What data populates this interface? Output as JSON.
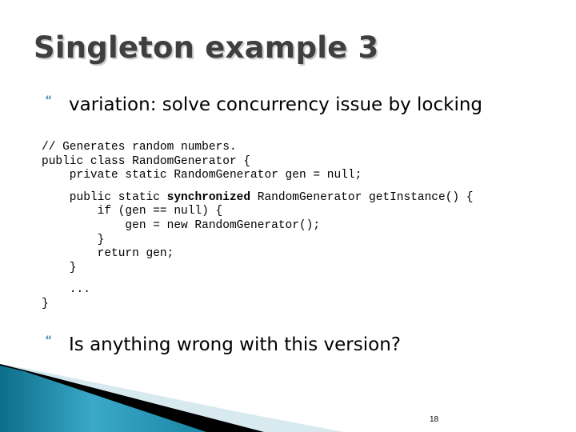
{
  "slide": {
    "title": "Singleton example 3",
    "bullets": [
      {
        "icon": "bullet-quote-icon",
        "text": "variation: solve concurrency issue by locking"
      },
      {
        "icon": "bullet-quote-icon",
        "text": "Is anything wrong with this version?"
      }
    ],
    "code": {
      "line1": "// Generates random numbers.",
      "line2": "public class RandomGenerator {",
      "line3": "    private static RandomGenerator gen = null;",
      "line4_pre": "    public static ",
      "line4_kw": "synchronized",
      "line4_post": " RandomGenerator getInstance() {",
      "line5": "        if (gen == null) {",
      "line6": "            gen = new RandomGenerator();",
      "line7": "        }",
      "line8": "        return gen;",
      "line9": "    }",
      "line10": "    ...",
      "line11": "}"
    },
    "page_number": "18",
    "colors": {
      "title": "#3f3f3f",
      "bullet": "#4a9bb0",
      "deco_teal": "#1d7f9c",
      "deco_light": "#d6e8ef"
    }
  }
}
